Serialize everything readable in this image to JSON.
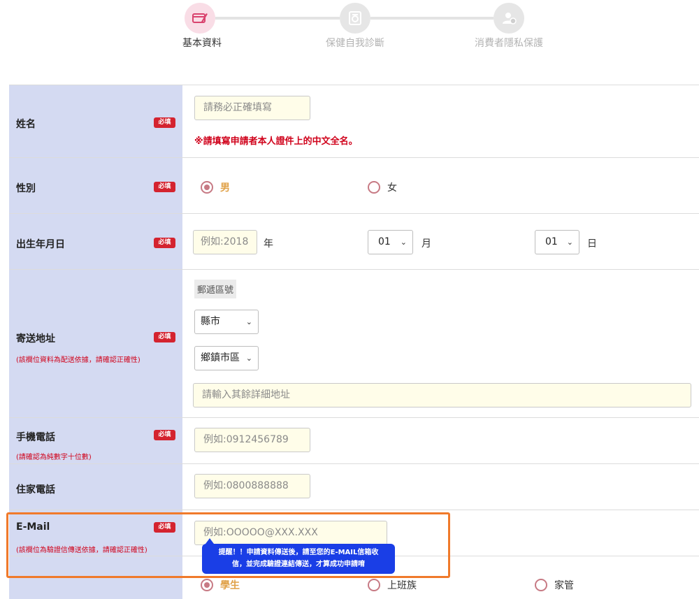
{
  "steps": [
    {
      "label": "基本資料",
      "icon": "edit-card-icon",
      "state": "active"
    },
    {
      "label": "保健自我診斷",
      "icon": "health-check-icon",
      "state": "inactive"
    },
    {
      "label": "消費者隱私保護",
      "icon": "privacy-user-icon",
      "state": "inactive"
    }
  ],
  "required_label": "必填",
  "name": {
    "label": "姓名",
    "placeholder": "請務必正確填寫",
    "warning": "※請填寫申請者本人證件上的中文全名。"
  },
  "gender": {
    "label": "性別",
    "options": [
      {
        "label": "男",
        "checked": true
      },
      {
        "label": "女",
        "checked": false
      }
    ]
  },
  "birthday": {
    "label": "出生年月日",
    "year_placeholder": "例如:2018",
    "year_unit": "年",
    "month_value": "01",
    "month_unit": "月",
    "day_value": "01",
    "day_unit": "日"
  },
  "address": {
    "label": "寄送地址",
    "note": "(該欄位資料為配送依據，請確認正確性)",
    "zip_label": "郵遞區號",
    "county_value": "縣市",
    "district_value": "鄉鎮市區",
    "detail_placeholder": "請輸入其餘詳細地址"
  },
  "mobile": {
    "label": "手機電話",
    "note": "(請確認為純數字十位數)",
    "placeholder": "例如:0912456789"
  },
  "home_phone": {
    "label": "住家電話",
    "placeholder": "例如:0800888888"
  },
  "email": {
    "label": "E-Mail",
    "note": "(該欄位為驗證信傳送依據，請確認正確性)",
    "placeholder": "例如:OOOOO@XXX.XXX",
    "tooltip_line1": "提醒！！申請資料傳送後，請至您的E-MAIL信箱收",
    "tooltip_line2": "信，並完成驗證連結傳送，才算成功申請唷"
  },
  "occupation": {
    "options": [
      {
        "label": "學生",
        "checked": true
      },
      {
        "label": "上班族",
        "checked": false
      },
      {
        "label": "家管",
        "checked": false
      }
    ]
  },
  "colors": {
    "label_bg": "#d4daf2",
    "required_bg": "#d4232f",
    "input_bg": "#fffde9",
    "radio_accent": "#c77a84",
    "checked_text": "#e0a148",
    "tooltip_bg": "#1a3ee6",
    "highlight_border": "#f07a2b"
  }
}
